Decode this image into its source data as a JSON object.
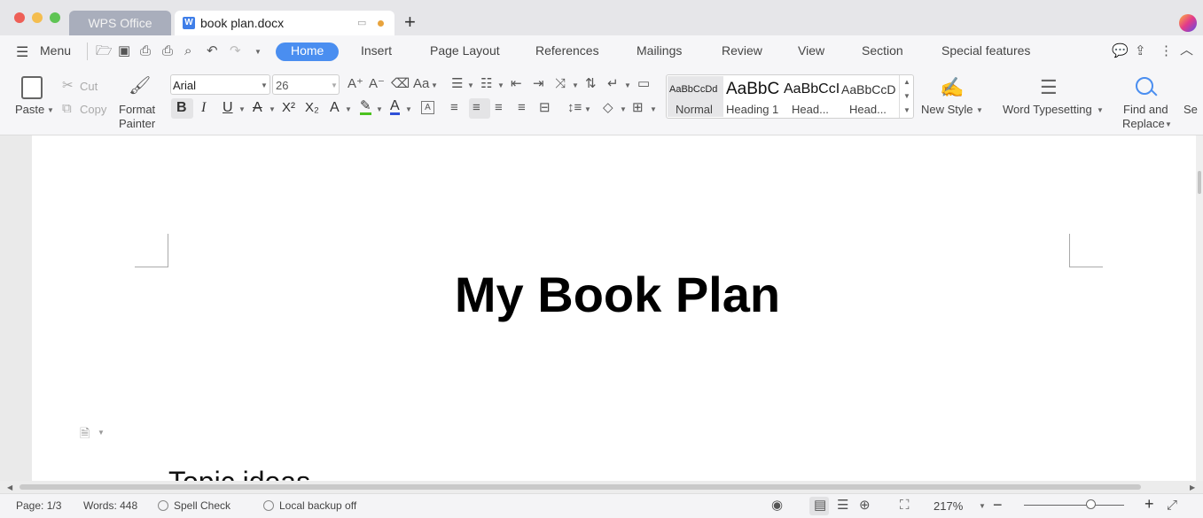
{
  "tabs": {
    "home_tab": "WPS Office",
    "doc_tab": "book plan.docx",
    "new_tab_glyph": "+"
  },
  "menubar": {
    "menu_label": "Menu",
    "items": [
      "Home",
      "Insert",
      "Page Layout",
      "References",
      "Mailings",
      "Review",
      "View",
      "Section",
      "Special features"
    ]
  },
  "ribbon": {
    "paste": "Paste",
    "cut": "Cut",
    "copy": "Copy",
    "format_painter_1": "Format",
    "format_painter_2": "Painter",
    "font_name": "Arial",
    "font_size": "26",
    "styles": [
      {
        "preview": "AaBbCcDd",
        "label": "Normal"
      },
      {
        "preview": "AaBbC",
        "label": "Heading 1"
      },
      {
        "preview": "AaBbCcI",
        "label": "Head..."
      },
      {
        "preview": "AaBbCcD",
        "label": "Head..."
      }
    ],
    "new_style": "New Style",
    "word_typesetting": "Word Typesetting",
    "find_replace_1": "Find and",
    "find_replace_2": "Replace",
    "select_partial": "Se"
  },
  "document": {
    "title": "My Book Plan",
    "heading_partial": "Topic ideas"
  },
  "status": {
    "page": "Page: 1/3",
    "words": "Words: 448",
    "spell_check": "Spell Check",
    "backup": "Local backup off",
    "zoom": "217%"
  },
  "colors": {
    "accent": "#4a8ef0",
    "close": "#ee5f57",
    "minimize": "#f4bd4f",
    "maximize": "#5fc454"
  }
}
